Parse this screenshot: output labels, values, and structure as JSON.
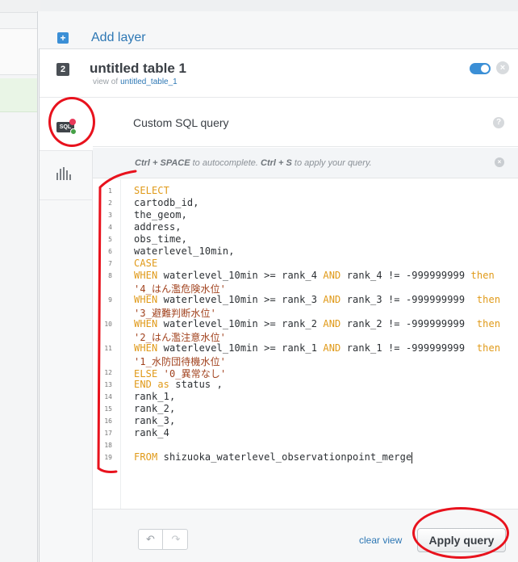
{
  "add_layer": {
    "label": "Add layer",
    "icon": "plus-icon"
  },
  "layer": {
    "number": "2",
    "title": "untitled table 1",
    "sub_prefix": "view of",
    "sub_link": "untitled_table_1",
    "visible": true
  },
  "panel": {
    "title": "Custom SQL query",
    "help": "?"
  },
  "hint": {
    "key1": "Ctrl + SPACE",
    "text1": " to autocomplete. ",
    "key2": "Ctrl + S",
    "text2": " to apply your query."
  },
  "editor": {
    "line_numbers": [
      "1",
      "2",
      "3",
      "4",
      "5",
      "6",
      "7",
      "8",
      "9",
      "10",
      "11",
      "12",
      "13",
      "14",
      "15",
      "16",
      "17",
      "18",
      "19"
    ],
    "lines": [
      "SELECT",
      "cartodb_id,",
      "the_geom,",
      "address,",
      "obs_time,",
      "waterlevel_10min,",
      "CASE",
      "WHEN waterlevel_10min >= rank_4 AND rank_4 != -999999999 then",
      "'4_はん濫危険水位'",
      "WHEN waterlevel_10min >= rank_3 AND rank_3 != -999999999  then",
      "'3_避難判断水位'",
      "WHEN waterlevel_10min >= rank_2 AND rank_2 != -999999999  then",
      "'2_はん濫注意水位'",
      "WHEN waterlevel_10min >= rank_1 AND rank_1 != -999999999  then",
      "'1_水防団待機水位'",
      "ELSE '0_異常なし'",
      "END as status ,",
      "rank_1,",
      "rank_2,",
      "rank_3,",
      "rank_4",
      "FROM shizuoka_waterlevel_observationpoint_merge"
    ]
  },
  "footer": {
    "undo": "↶",
    "redo": "↷",
    "clear_view": "clear view",
    "apply": "Apply query"
  },
  "colors": {
    "keyword": "#e09a19",
    "string": "#a1421e",
    "accent": "#3b8fd6",
    "annotation": "#e8121d"
  }
}
